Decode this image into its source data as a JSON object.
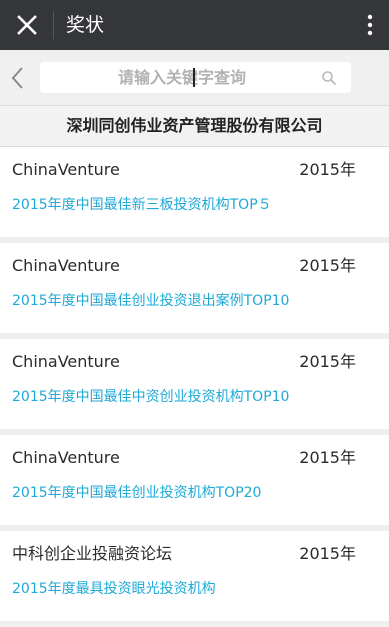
{
  "header": {
    "title": "奖状"
  },
  "search": {
    "placeholder": "请输入关键字查询"
  },
  "company": {
    "name": "深圳同创伟业资产管理股份有限公司"
  },
  "awards": [
    {
      "org": "ChinaVenture",
      "year": "2015年",
      "name": "2015年度中国最佳新三板投资机构TOP５"
    },
    {
      "org": "ChinaVenture",
      "year": "2015年",
      "name": "2015年度中国最佳创业投资退出案例TOP10"
    },
    {
      "org": "ChinaVenture",
      "year": "2015年",
      "name": "2015年度中国最佳中资创业投资机构TOP10"
    },
    {
      "org": "ChinaVenture",
      "year": "2015年",
      "name": "2015年度中国最佳创业投资机构TOP20"
    },
    {
      "org": "中科创企业投融资论坛",
      "year": "2015年",
      "name": "2015年度最具投资眼光投资机构"
    }
  ],
  "colors": {
    "appbar": "#35363a",
    "link": "#1ea9d6",
    "background": "#f0f0f0"
  },
  "icons": {
    "close": "close-icon",
    "more": "more-vertical-icon",
    "back": "chevron-left-icon",
    "search": "search-icon"
  }
}
